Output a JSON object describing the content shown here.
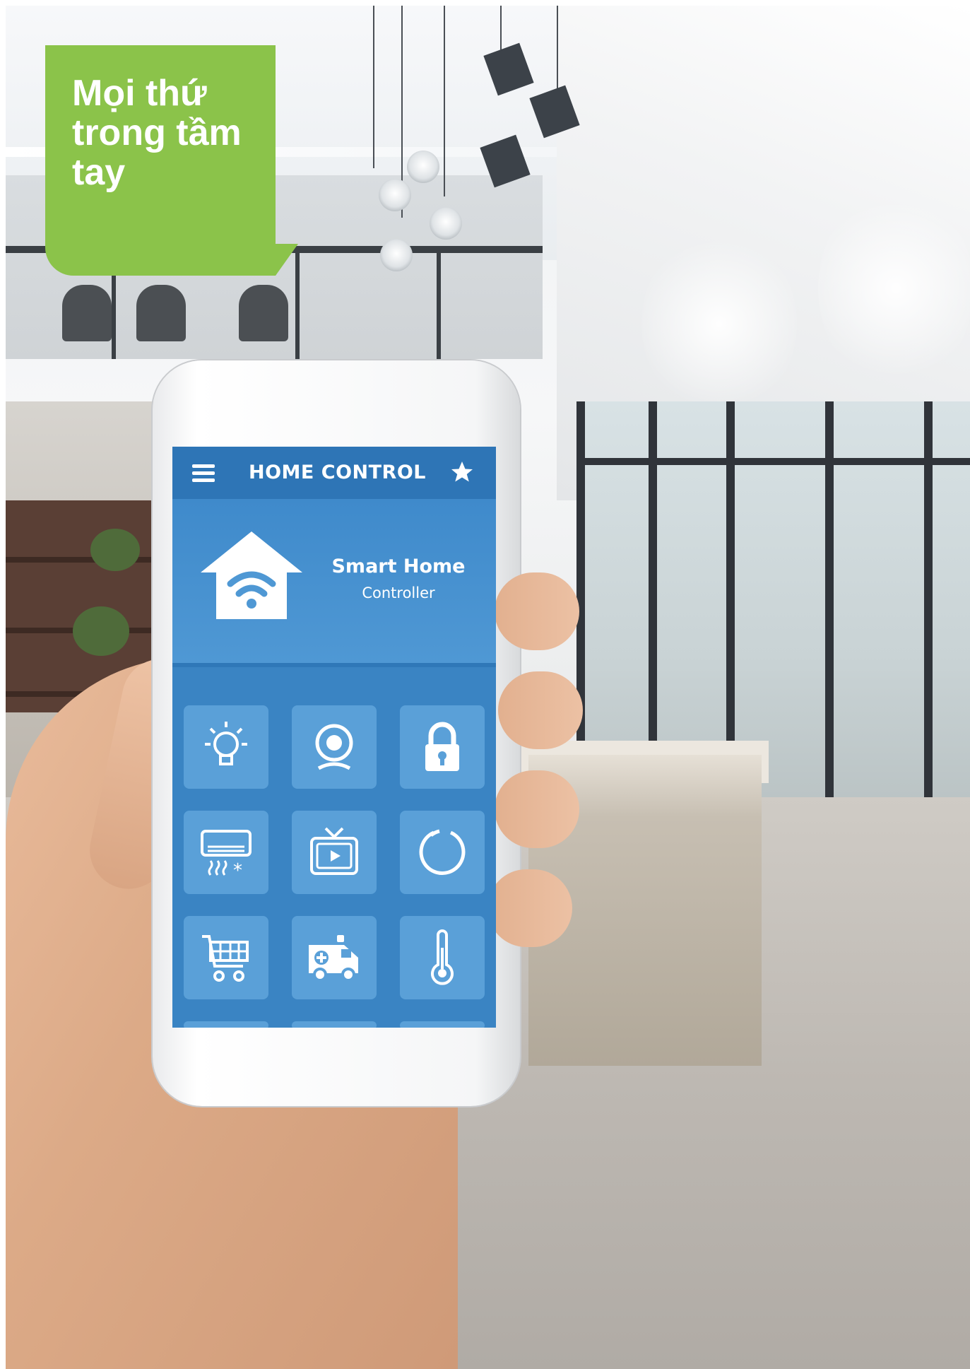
{
  "banner": {
    "text": "Mọi thứ trong tầm tay",
    "color": "#8bc34a"
  },
  "app": {
    "header_title": "HOME CONTROL",
    "hero_title": "Smart Home",
    "hero_subtitle": "Controller",
    "colors": {
      "header": "#2e75b6",
      "body": "#3d86c4",
      "tile": "#5aa0d8"
    },
    "tiles": [
      {
        "icon": "light-bulb-icon"
      },
      {
        "icon": "camera-icon"
      },
      {
        "icon": "lock-icon"
      },
      {
        "icon": "air-conditioner-icon"
      },
      {
        "icon": "tv-icon"
      },
      {
        "icon": "power-icon"
      },
      {
        "icon": "shopping-cart-icon"
      },
      {
        "icon": "ambulance-icon"
      },
      {
        "icon": "thermometer-icon"
      }
    ]
  }
}
